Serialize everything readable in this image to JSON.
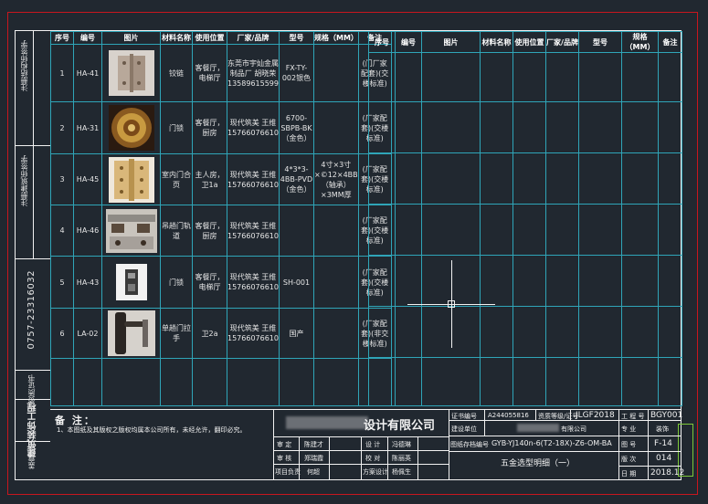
{
  "left_strip": {
    "labels_top": "注册结构师签字",
    "labels_mid": "注册建筑师签字",
    "phone": "0757-23316032",
    "label_a": "资质证书",
    "label_b": "建筑装饰工程",
    "label_c": "盖章区"
  },
  "table_headers": [
    "序号",
    "编号",
    "图片",
    "材料名称",
    "使用位置",
    "厂家/品牌",
    "型号",
    "规格（MM）",
    "备注"
  ],
  "rows": [
    {
      "no": "1",
      "code": "HA-41",
      "name": "铰链",
      "location": "客餐厅，电梯厅",
      "brand": "东莞市宇灿金属制品厂 胡晓荣 13589615599",
      "model": "FX-TY-002银色",
      "spec": "",
      "note": "(门厂家配套)(交楼标准)"
    },
    {
      "no": "2",
      "code": "HA-31",
      "name": "门锁",
      "location": "客餐厅，厨房",
      "brand": "现代筑美 王维 15766076610",
      "model": "6700-SBPB-BK（金色）",
      "spec": "",
      "note": "(厂家配套)(交楼标准)"
    },
    {
      "no": "3",
      "code": "HA-45",
      "name": "室内门合页",
      "location": "主人房，卫1a",
      "brand": "现代筑美 王维 15766076610",
      "model": "4*3*3-4BB-PVD（金色）",
      "spec": "4寸×3寸×©12×4BB（轴承）×3MM厚",
      "note": "(厂家配套)(交楼标准)"
    },
    {
      "no": "4",
      "code": "HA-46",
      "name": "吊趟门轨道",
      "location": "客餐厅，厨房",
      "brand": "现代筑美 王维 15766076610",
      "model": "",
      "spec": "",
      "note": "(厂家配套)(交楼标准)"
    },
    {
      "no": "5",
      "code": "HA-43",
      "name": "门锁",
      "location": "客餐厅，电梯厅",
      "brand": "现代筑美 王维 15766076610",
      "model": "SH-001",
      "spec": "",
      "note": "(厂家配套)(交楼标准)"
    },
    {
      "no": "6",
      "code": "LA-02",
      "name": "单趟门拉手",
      "location": "卫2a",
      "brand": "现代筑美 王维 15766076610",
      "model": "国产",
      "spec": "",
      "note": "(厂家配套)(非交楼标准)"
    }
  ],
  "notes": {
    "title": "备 注：",
    "text": "1、本图纸及其版权之版权均属本公司所有，未经允许，翻印必究。"
  },
  "title_block": {
    "company": "设计有限公司",
    "cert_label": "证书编号",
    "cert_value": "A244055816",
    "qualif_label": "资质等级/证号",
    "qualif_value": "JLGF2018",
    "project_no_label": "工 程 号",
    "project_no_value": "BGY001",
    "client_label": "建设单位",
    "client_value": "有限公司",
    "discipline_label": "专 业",
    "discipline_value": "装饰",
    "drawing_file_label": "图纸存档编号",
    "drawing_file_value": "GYB-YJ140n-6(T2-18X)-Z6-OM-BA",
    "sheet_label": "图 号",
    "sheet_value": "F-14",
    "version_label": "版 次",
    "version_value": "014",
    "date_label": "日 期",
    "date_value": "2018.12",
    "approve_label": "审 定",
    "approve_name": "陈建才",
    "review_label": "审 核",
    "review_name": "郑瑞霞",
    "proj_lead_label": "项目负责",
    "proj_lead_name": "何超",
    "design_label": "设 计",
    "design_name": "冯德琳",
    "check_label": "校 对",
    "check_name": "陈丽英",
    "draw_label": "方案设计",
    "draw_name": "杨佩生",
    "drawing_title": "五金选型明细（一）"
  }
}
